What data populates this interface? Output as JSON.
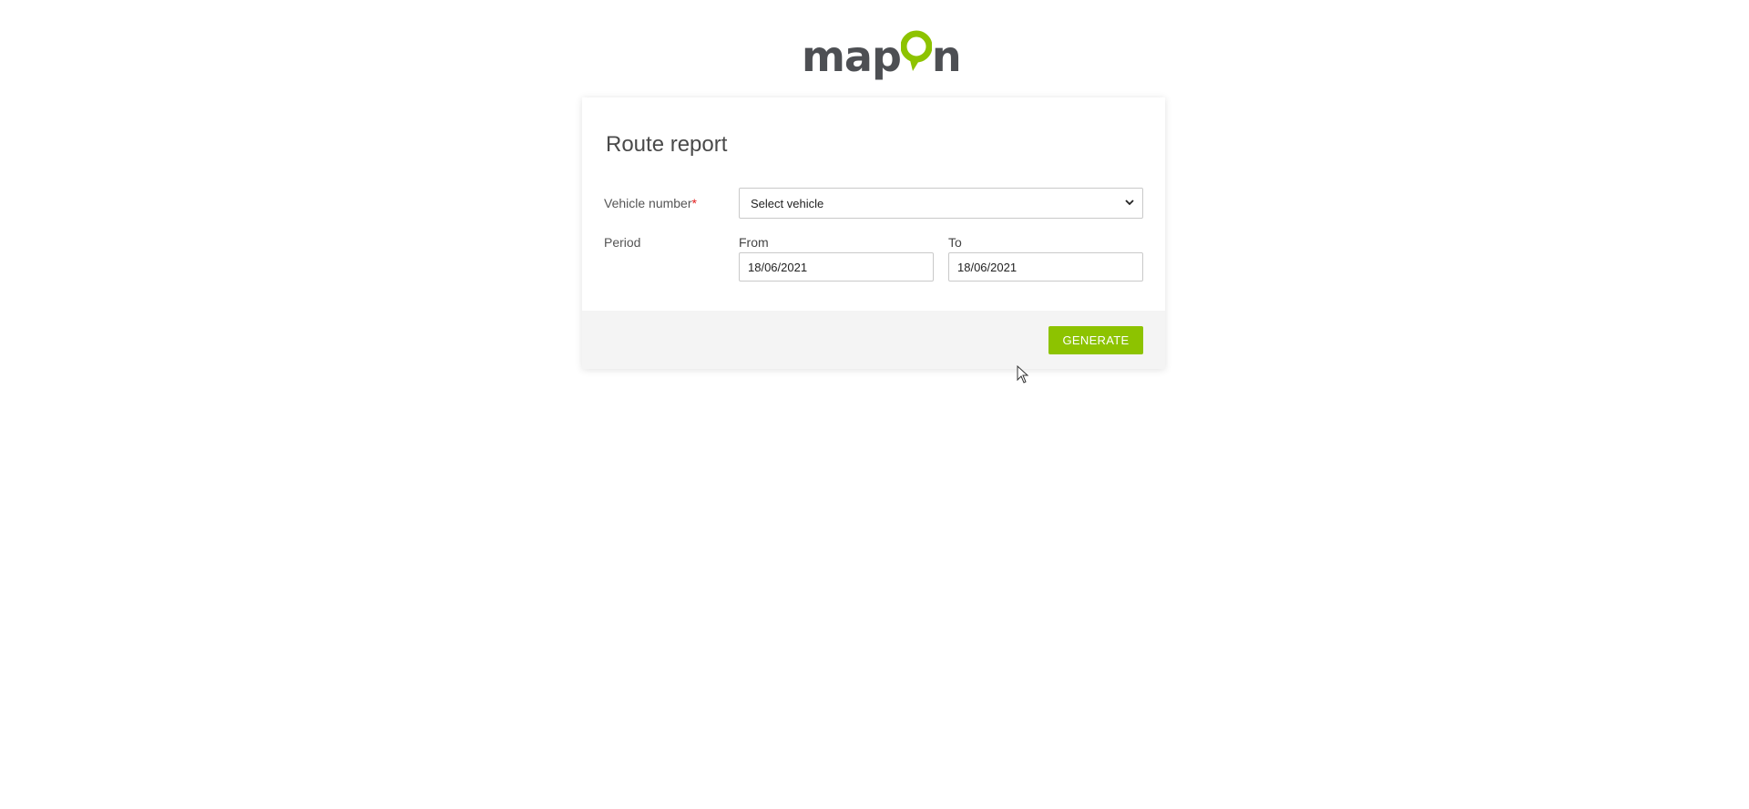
{
  "brand": {
    "logo_text_left": "map",
    "logo_text_right": "n",
    "logo_colors": {
      "text": "#4d4f53",
      "pin": "#8dc300"
    }
  },
  "report": {
    "title": "Route report",
    "vehicle_label": "Vehicle number",
    "required_mark": "*",
    "vehicle_select_value": "Select vehicle",
    "period_label": "Period",
    "from_label": "From",
    "from_value": "18/06/2021",
    "to_label": "To",
    "to_value": "18/06/2021",
    "generate_label": "GENERATE"
  },
  "colors": {
    "accent": "#8dc300",
    "required": "#e21b1b",
    "footer_bg": "#f4f4f4"
  },
  "icons": {
    "select_arrow": "chevron-down-icon",
    "logo_pin": "map-pin-icon",
    "cursor": "mouse-pointer-icon"
  }
}
